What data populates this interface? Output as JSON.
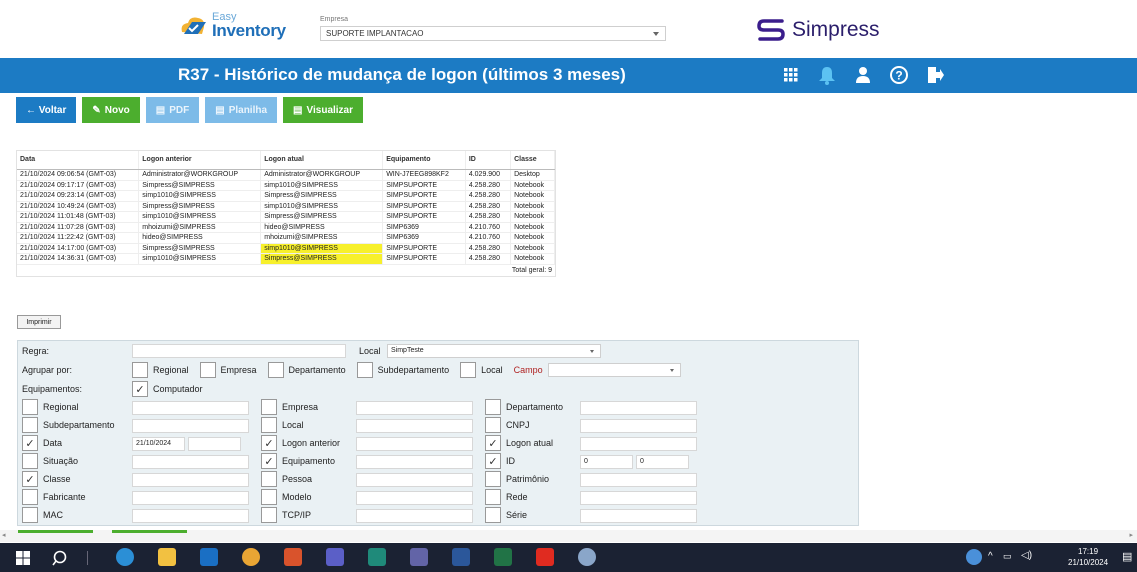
{
  "brand": {
    "easy": "Easy",
    "inventory": "Inventory",
    "simpress": "Simpress"
  },
  "empresa": {
    "label": "Empresa",
    "value": "SUPORTE IMPLANTACAO"
  },
  "page_title": "R37 - Histórico de mudança de logon (últimos 3 meses)",
  "header_icons": [
    "grid-icon",
    "bell-icon",
    "user-icon",
    "help-icon",
    "logout-icon"
  ],
  "toolbar": {
    "voltar": "← Voltar",
    "novo": "Novo",
    "pdf": "PDF",
    "planilha": "Planilha",
    "visualizar": "Visualizar"
  },
  "report": {
    "columns": [
      "Data",
      "Logon anterior",
      "Logon atual",
      "Equipamento",
      "ID",
      "Classe"
    ],
    "rows": [
      [
        "21/10/2024 09:06:54 (GMT-03)",
        "Administrator@WORKGROUP",
        "Administrator@WORKGROUP",
        "WIN-J7EEG898KF2",
        "4.029.900",
        "Desktop"
      ],
      [
        "21/10/2024 09:17:17 (GMT-03)",
        "Simpress@SIMPRESS",
        "simp1010@SIMPRESS",
        "SIMPSUPORTE",
        "4.258.280",
        "Notebook"
      ],
      [
        "21/10/2024 09:23:14 (GMT-03)",
        "simp1010@SIMPRESS",
        "Simpress@SIMPRESS",
        "SIMPSUPORTE",
        "4.258.280",
        "Notebook"
      ],
      [
        "21/10/2024 10:49:24 (GMT-03)",
        "Simpress@SIMPRESS",
        "simp1010@SIMPRESS",
        "SIMPSUPORTE",
        "4.258.280",
        "Notebook"
      ],
      [
        "21/10/2024 11:01:48 (GMT-03)",
        "simp1010@SIMPRESS",
        "Simpress@SIMPRESS",
        "SIMPSUPORTE",
        "4.258.280",
        "Notebook"
      ],
      [
        "21/10/2024 11:07:28 (GMT-03)",
        "mhoizumi@SIMPRESS",
        "hideo@SIMPRESS",
        "SIMP6369",
        "4.210.760",
        "Notebook"
      ],
      [
        "21/10/2024 11:22:42 (GMT-03)",
        "hideo@SIMPRESS",
        "mhoizumi@SIMPRESS",
        "SIMP6369",
        "4.210.760",
        "Notebook"
      ],
      [
        "21/10/2024 14:17:00 (GMT-03)",
        "Simpress@SIMPRESS",
        "simp1010@SIMPRESS",
        "SIMPSUPORTE",
        "4.258.280",
        "Notebook"
      ],
      [
        "21/10/2024 14:36:31 (GMT-03)",
        "simp1010@SIMPRESS",
        "Simpress@SIMPRESS",
        "SIMPSUPORTE",
        "4.258.280",
        "Notebook"
      ]
    ],
    "highlight_rows": [
      7,
      8
    ],
    "highlight_color": "#f7f02c",
    "total": "Total geral: 9",
    "print_label": "Imprimir"
  },
  "filters": {
    "regra_label": "Regra:",
    "regra_value": "",
    "local_label": "Local",
    "local_value": "SimpTeste",
    "agrupar_label": "Agrupar por:",
    "group": [
      "Regional",
      "Empresa",
      "Departamento",
      "Subdepartamento",
      "Local"
    ],
    "campo_label": "Campo",
    "equip_label": "Equipamentos:",
    "equip_option": "Computador",
    "fields": {
      "regional": "Regional",
      "subdepartamento": "Subdepartamento",
      "data": "Data",
      "data_value": "21/10/2024",
      "situacao": "Situação",
      "classe": "Classe",
      "fabricante": "Fabricante",
      "mac": "MAC",
      "empresa": "Empresa",
      "local": "Local",
      "logon_anterior": "Logon anterior",
      "equipamento": "Equipamento",
      "pessoa": "Pessoa",
      "modelo": "Modelo",
      "tcpip": "TCP/IP",
      "departamento": "Departamento",
      "cnpj": "CNPJ",
      "logon_atual": "Logon atual",
      "id": "ID",
      "id_from": "0",
      "id_to": "0",
      "patrimonio": "Patrimônio",
      "rede": "Rede",
      "serie": "Série"
    }
  },
  "taskbar": {
    "time": "17:19",
    "date": "21/10/2024"
  },
  "colors": {
    "blue": "#1c7bc4",
    "green": "#4cae2e",
    "light_blue": "#7dbbe8"
  }
}
